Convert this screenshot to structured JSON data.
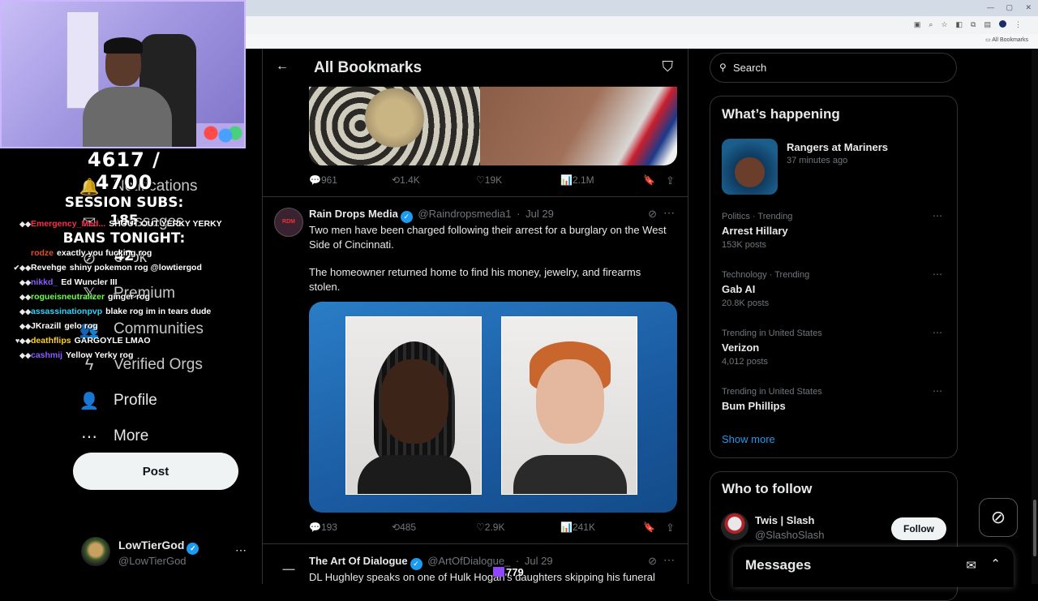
{
  "browser": {
    "bookmark_bar_label": "All Bookmarks",
    "window_controls": [
      "—",
      "▢",
      "✕"
    ]
  },
  "stream": {
    "sub_count": "4617 / 4700",
    "session_subs": "SESSION SUBS: 185",
    "bans_tonight": "BANS TONIGHT: 42",
    "viewer_count": "779",
    "chat": [
      {
        "badges": "◆◆",
        "user": "Emergency_Med...",
        "user_color": "#ff2b4a",
        "msg": "SHOUT OUT YERKY YERKY"
      },
      {
        "badges": "",
        "user": "",
        "user_color": "#ffffff",
        "msg": ""
      },
      {
        "badges": "",
        "user": "rodze",
        "user_color": "#e0502b",
        "msg": "exactly you fucking rog"
      },
      {
        "badges": "✔◆◆",
        "user": "Revehge",
        "user_color": "#ffffff",
        "msg": "shiny pokemon rog  @lowtiergod"
      },
      {
        "badges": "◆◆",
        "user": "nikkd_",
        "user_color": "#8a5cff",
        "msg": "Ed Wuncler III"
      },
      {
        "badges": "◆◆",
        "user": "rogueisneutralizer",
        "user_color": "#6cff4a",
        "msg": "ginger rog"
      },
      {
        "badges": "◆◆",
        "user": "assassinationpvp",
        "user_color": "#2ad6ff",
        "msg": "blake rog im in tears dude"
      },
      {
        "badges": "◆◆",
        "user": "JKrazill",
        "user_color": "#ffffff",
        "msg": "gelo rog"
      },
      {
        "badges": "♥◆◆",
        "user": "deathflips",
        "user_color": "#ffd12a",
        "msg": "GARGOYLE LMAO"
      },
      {
        "badges": "◆◆",
        "user": "cashmij",
        "user_color": "#8a5cff",
        "msg": "Yellow Yerky rog"
      }
    ]
  },
  "sidebar": {
    "items": [
      {
        "icon": "bell-icon",
        "glyph": "🔔",
        "label": "Notifications"
      },
      {
        "icon": "mail-icon",
        "glyph": "✉",
        "label": "Messages"
      },
      {
        "icon": "grok-icon",
        "glyph": "⊘",
        "label": "Grok"
      },
      {
        "icon": "x-logo-icon",
        "glyph": "𝕏",
        "label": "Premium"
      },
      {
        "icon": "communities-icon",
        "glyph": "👥",
        "label": "Communities"
      },
      {
        "icon": "lightning-icon",
        "glyph": "ϟ",
        "label": "Verified Orgs"
      },
      {
        "icon": "profile-icon",
        "glyph": "👤",
        "label": "Profile"
      },
      {
        "icon": "more-icon",
        "glyph": "⋯",
        "label": "More"
      }
    ],
    "post_label": "Post",
    "account": {
      "name": "LowTierGod",
      "handle": "@LowTierGod"
    }
  },
  "feed": {
    "title": "All Bookmarks",
    "tweets": [
      {
        "actions": {
          "replies": "961",
          "reposts": "1.4K",
          "likes": "19K",
          "views": "2.1M"
        }
      },
      {
        "author": "Rain Drops Media",
        "handle": "@Raindropsmedia1",
        "date": "Jul 29",
        "avatar_text": "RDM",
        "text_1": "Two men have been charged following their arrest for a burglary on the West Side of Cincinnati.",
        "text_2": "The homeowner returned home to find his money, jewelry, and firearms stolen.",
        "actions": {
          "replies": "193",
          "reposts": "485",
          "likes": "2.9K",
          "views": "241K"
        }
      },
      {
        "author": "The Art Of Dialogue",
        "handle": "@ArtOfDialogue_",
        "date": "Jul 29",
        "text_1": "DL Hughley speaks on one of Hulk Hogan's daughters skipping his funeral"
      }
    ]
  },
  "right": {
    "search_placeholder": "Search",
    "happening": {
      "title": "What’s happening",
      "event": {
        "title": "Rangers at Mariners",
        "time": "37 minutes ago"
      },
      "trends": [
        {
          "category": "Politics · Trending",
          "name": "Arrest Hillary",
          "posts": "153K posts"
        },
        {
          "category": "Technology · Trending",
          "name": "Gab AI",
          "posts": "20.8K posts"
        },
        {
          "category": "Trending in United States",
          "name": "Verizon",
          "posts": "4,012 posts"
        },
        {
          "category": "Trending in United States",
          "name": "Bum Phillips",
          "posts": ""
        }
      ],
      "show_more": "Show more"
    },
    "who_to_follow": {
      "title": "Who to follow",
      "user": {
        "name": "Twis | Slash",
        "handle": "@SlashoSlash"
      },
      "follow_label": "Follow"
    }
  },
  "messages_drawer": {
    "title": "Messages"
  },
  "colors": {
    "accent": "#1d9bf0",
    "background": "#000000",
    "text": "#e7e9ea",
    "muted": "#71767b",
    "border": "#2f3336"
  }
}
